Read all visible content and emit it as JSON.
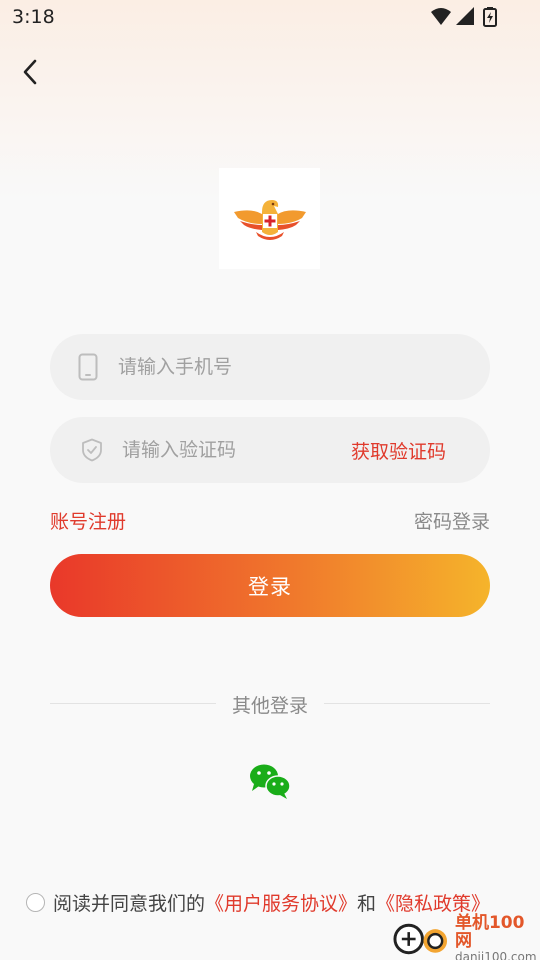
{
  "status_bar": {
    "time": "3:18"
  },
  "form": {
    "phone_placeholder": "请输入手机号",
    "code_placeholder": "请输入验证码",
    "get_code_label": "获取验证码"
  },
  "links": {
    "register": "账号注册",
    "password_login": "密码登录"
  },
  "login_button": "登录",
  "other_login": {
    "title": "其他登录"
  },
  "agreement": {
    "prefix": "阅读并同意我们的",
    "user_agreement": "《用户服务协议》",
    "and": "和",
    "privacy_policy": "《隐私政策》"
  },
  "watermark": {
    "cn": "单机100网",
    "en": "danji100.com"
  },
  "colors": {
    "accent": "#e03a2c",
    "button_gradient_start": "#e9382a",
    "button_gradient_end": "#f5b42b",
    "wechat_green": "#1aad19"
  },
  "icons": [
    "back-arrow-icon",
    "phone-icon",
    "shield-check-icon",
    "wechat-icon",
    "wifi-icon",
    "signal-icon",
    "battery-icon",
    "app-logo"
  ]
}
